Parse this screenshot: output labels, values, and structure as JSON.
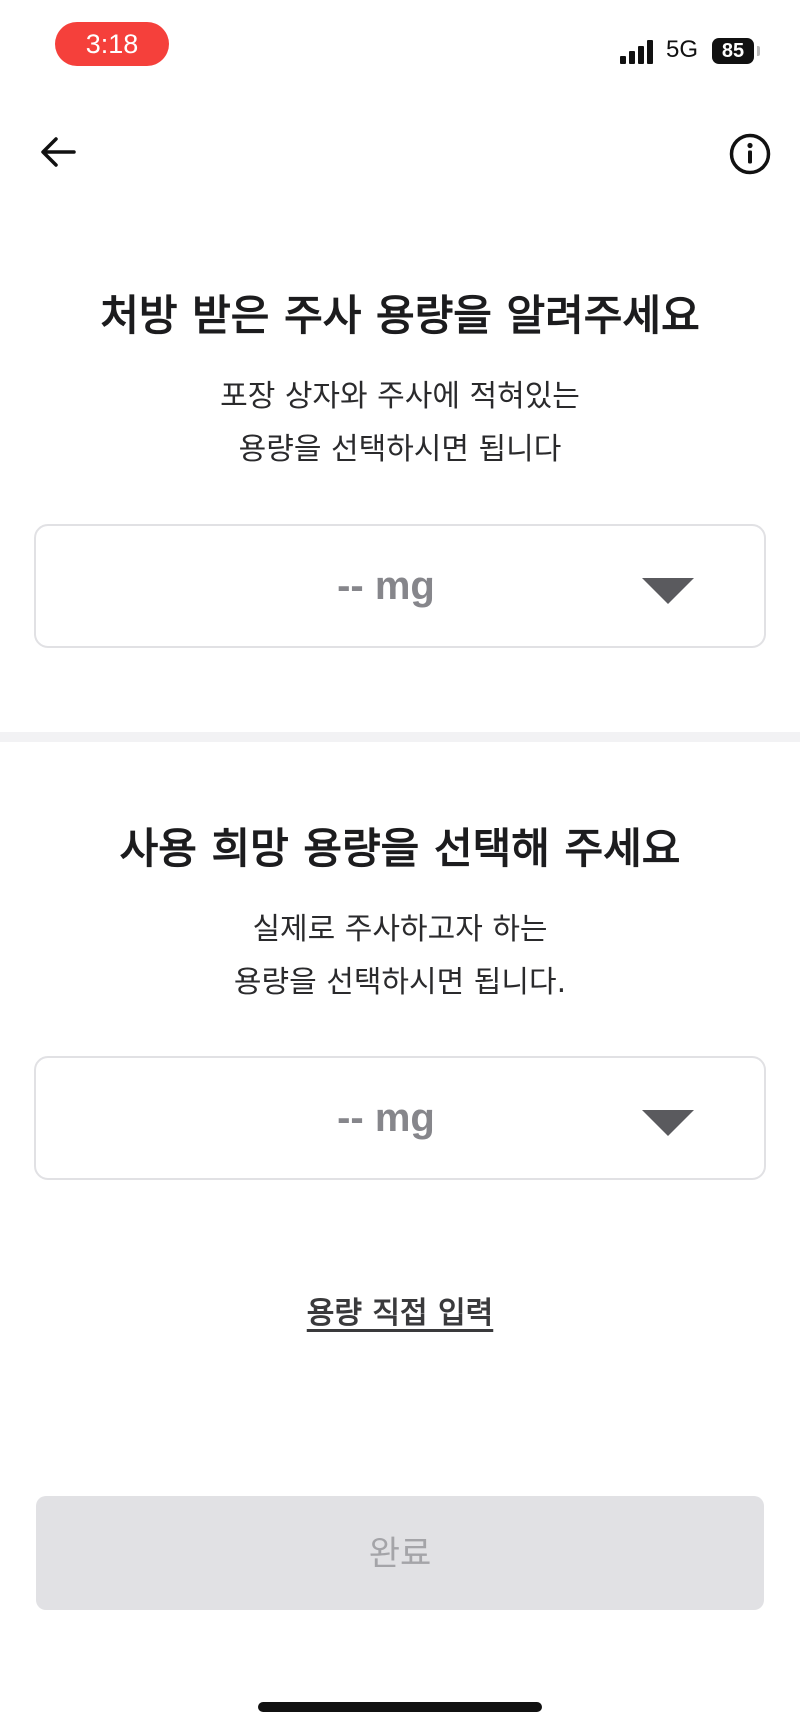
{
  "status_bar": {
    "time": "3:18",
    "network": "5G",
    "battery": "85"
  },
  "header": {
    "back_icon": "arrow-left-icon",
    "info_icon": "info-circle-icon"
  },
  "prescribed_section": {
    "title": "처방 받은 주사 용량을 알려주세요",
    "desc_line1": "포장 상자와 주사에 적혀있는",
    "desc_line2": "용량을 선택하시면 됩니다",
    "dropdown_value": "-- mg"
  },
  "desired_section": {
    "title": "사용 희망 용량을 선택해 주세요",
    "desc_line1": "실제로 주사하고자 하는",
    "desc_line2": "용량을 선택하시면 됩니다.",
    "dropdown_value": "-- mg"
  },
  "manual_input_link": "용량 직접 입력",
  "done_button": "완료",
  "colors": {
    "time_pill": "#f5403b",
    "disabled_button_bg": "#e1e1e4",
    "disabled_button_text": "#a4a4a8",
    "placeholder_text": "#86868b"
  }
}
